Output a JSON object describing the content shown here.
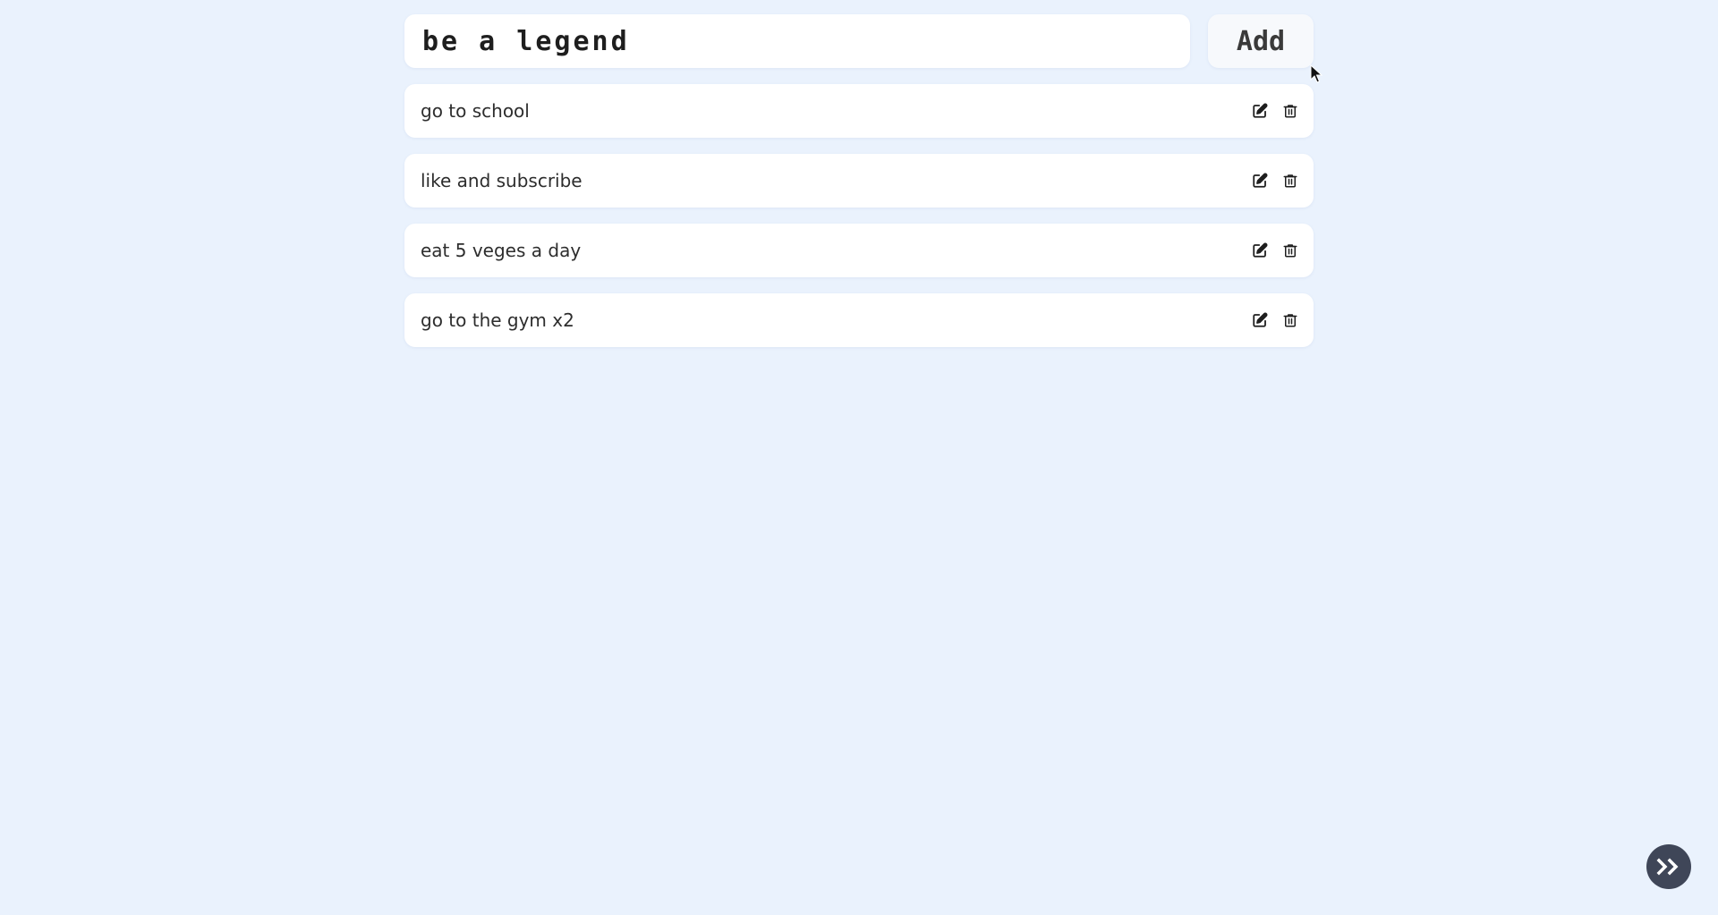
{
  "new_todo": {
    "value": "be a legend",
    "add_label": "Add"
  },
  "todos": [
    {
      "text": "go to school",
      "edit_icon": "edit-icon",
      "delete_icon": "trash-icon"
    },
    {
      "text": "like and subscribe",
      "edit_icon": "edit-icon",
      "delete_icon": "trash-icon"
    },
    {
      "text": "eat 5 veges a day",
      "edit_icon": "edit-icon",
      "delete_icon": "trash-icon"
    },
    {
      "text": "go to the gym x2",
      "edit_icon": "edit-icon",
      "delete_icon": "trash-icon"
    }
  ],
  "fab": {
    "icon": "double-chevron-right-icon"
  },
  "colors": {
    "background": "#eaf2fd",
    "card": "#ffffff",
    "fab": "#3f4658",
    "text": "#2d2d2d"
  }
}
